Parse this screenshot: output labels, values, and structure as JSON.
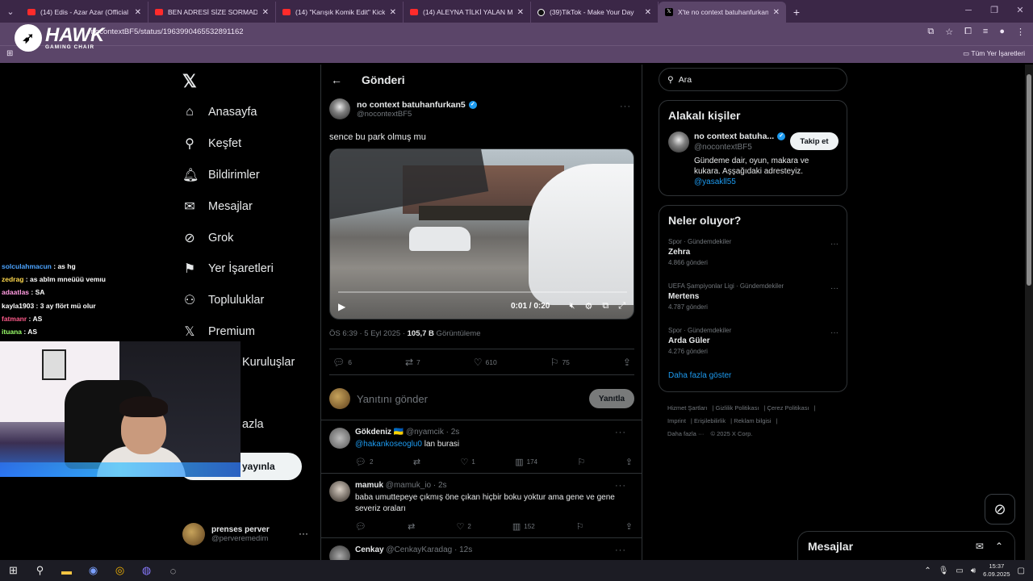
{
  "browser": {
    "tabs": [
      {
        "title": "(14) Edis - Azar Azar (Official Vi",
        "icon": "youtube"
      },
      {
        "title": "BEN ADRESİ SİZE SORMADIM",
        "icon": "youtube"
      },
      {
        "title": "(14) \"Karışık Komik Edit\" Kick &",
        "icon": "youtube"
      },
      {
        "title": "(14) ALEYNA TİLKİ YALAN MAK",
        "icon": "youtube"
      },
      {
        "title": "(39)TikTok - Make Your Day",
        "icon": "tiktok"
      },
      {
        "title": "X'te no context batuhanfurkan5",
        "icon": "x",
        "active": true
      }
    ],
    "url": "/nocontextBF5/status/1963990465532891162",
    "bookmarks_label": "Tüm Yer İşaretleri"
  },
  "overlay": {
    "brand": "HAWK",
    "brand_sub": "GAMING CHAIR",
    "chat": [
      {
        "user": "solculahmacun",
        "msg": "as hg"
      },
      {
        "user": "zedrag",
        "msg": "as ablm mneüüü vemıu"
      },
      {
        "user": "adaatlas",
        "msg": "SA"
      },
      {
        "user": "kayla1903",
        "msg": "3 ay flört mü olur"
      },
      {
        "user": "fatmanr",
        "msg": "AS"
      },
      {
        "user": "ituana",
        "msg": "AS"
      }
    ]
  },
  "nav": {
    "items": [
      {
        "label": "Anasayfa",
        "icon": "home-icon"
      },
      {
        "label": "Keşfet",
        "icon": "search-icon"
      },
      {
        "label": "Bildirimler",
        "icon": "bell-icon"
      },
      {
        "label": "Mesajlar",
        "icon": "mail-icon"
      },
      {
        "label": "Grok",
        "icon": "grok-icon"
      },
      {
        "label": "Yer İşaretleri",
        "icon": "bookmark-icon"
      },
      {
        "label": "Topluluklar",
        "icon": "people-icon"
      },
      {
        "label": "Premium",
        "icon": "x-icon"
      }
    ],
    "kurulus": "Kuruluşlar",
    "more": "azla",
    "post_button": "yayınla",
    "account": {
      "name": "prenses perver",
      "handle": "@perveremedim"
    }
  },
  "main": {
    "header": "Gönderi",
    "tweet": {
      "name": "no context batuhanfurkan5",
      "handle": "@nocontextBF5",
      "text": "sence bu park olmuş mu",
      "video_time": "0:01 / 0:20",
      "time": "ÖS 6:39 · 5 Eyl 2025 · ",
      "views": "105,7 B",
      "views_label": " Görüntüleme",
      "replies": "6",
      "retweets": "7",
      "likes": "610",
      "bookmarks": "75"
    },
    "reply_placeholder": "Yanıtını gönder",
    "reply_button": "Yanıtla",
    "comments": [
      {
        "name": "Gökdeniz 🇺🇦",
        "handle": "@nyamcik · 2s",
        "mention": "@hakankoseoglu0",
        "text": " lan burasi",
        "replies": "2",
        "likes": "1",
        "views": "174"
      },
      {
        "name": "mamuk",
        "handle": "@mamuk_io · 2s",
        "mention": "",
        "text": "baba umuttepeye çıkmış öne çıkan hiçbir boku yoktur ama gene ve gene severiz oraları",
        "replies": "",
        "likes": "2",
        "views": "152"
      },
      {
        "name": "Cenkay",
        "handle": "@CenkayKaradag · 12s",
        "mention": "",
        "text": "",
        "replies": "",
        "likes": "",
        "views": ""
      }
    ]
  },
  "right": {
    "search_placeholder": "Ara",
    "relevant_title": "Alakalı kişiler",
    "relevant": {
      "name": "no context batuha...",
      "handle": "@nocontextBF5",
      "bio": "Gündeme dair, oyun, makara ve kukara. Aşşağıdaki adresteyiz.",
      "link": "@yasakll55",
      "follow": "Takip et"
    },
    "trends_title": "Neler oluyor?",
    "trends": [
      {
        "category": "Spor · Gündemdekiler",
        "name": "Zehra",
        "count": "4.866 gönderi"
      },
      {
        "category": "UEFA Şampiyonlar Ligi · Gündemdekiler",
        "name": "Mertens",
        "count": "4.787 gönderi"
      },
      {
        "category": "Spor · Gündemdekiler",
        "name": "Arda Güler",
        "count": "4.276 gönderi"
      }
    ],
    "show_more": "Daha fazla göster",
    "footer": [
      "Hizmet Şartları",
      "Gizlilik Politikası",
      "Çerez Politikası",
      "Imprint",
      "Erişilebilirlik",
      "Reklam bilgisi",
      "Daha fazla ···",
      "© 2025 X Corp."
    ]
  },
  "messages": {
    "title": "Mesajlar"
  },
  "taskbar": {
    "time": "15:37",
    "date": "6.09.2025"
  }
}
